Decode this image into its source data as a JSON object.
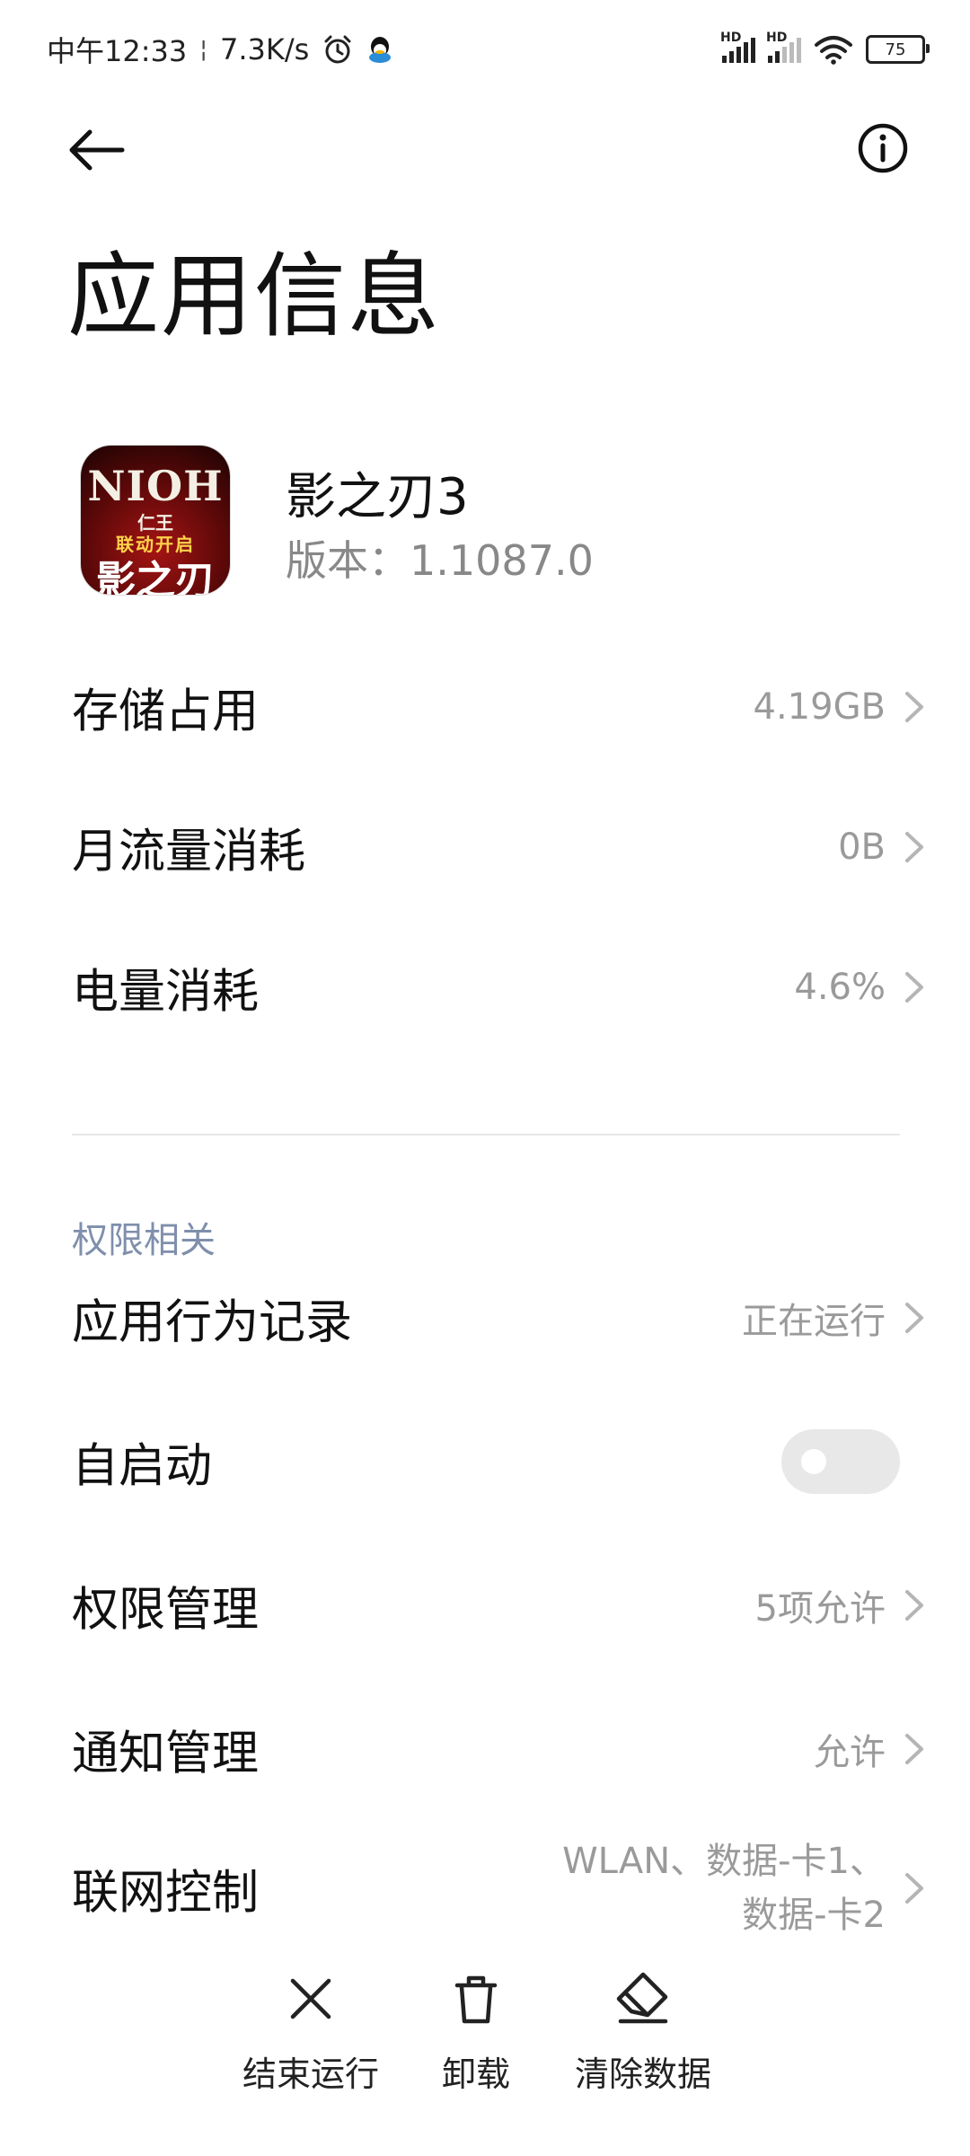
{
  "status_bar": {
    "time": "中午12:33",
    "net_speed": "7.3K/s",
    "signal1_tag": "HD",
    "signal2_tag": "HD",
    "battery": "75"
  },
  "header": {
    "title": "应用信息"
  },
  "app": {
    "name": "影之刃3",
    "version": "版本：1.1087.0",
    "icon_text": {
      "line1": "NIOH",
      "line2": "仁王",
      "line3": "联动开启",
      "line4": "影之刃"
    }
  },
  "usage_rows": [
    {
      "label": "存储占用",
      "value": "4.19GB"
    },
    {
      "label": "月流量消耗",
      "value": "0B"
    },
    {
      "label": "电量消耗",
      "value": "4.6%"
    }
  ],
  "permissions": {
    "section_label": "权限相关",
    "behavior_record": {
      "label": "应用行为记录",
      "value": "正在运行"
    },
    "autostart": {
      "label": "自启动",
      "enabled": false
    },
    "permission_mgmt": {
      "label": "权限管理",
      "value": "5项允许"
    },
    "notification_mgmt": {
      "label": "通知管理",
      "value": "允许"
    },
    "network_control": {
      "label": "联网控制",
      "value_line1": "WLAN、数据-卡1、",
      "value_line2": "数据-卡2"
    }
  },
  "bottom_actions": {
    "force_stop": "结束运行",
    "uninstall": "卸载",
    "clear_data": "清除数据"
  }
}
